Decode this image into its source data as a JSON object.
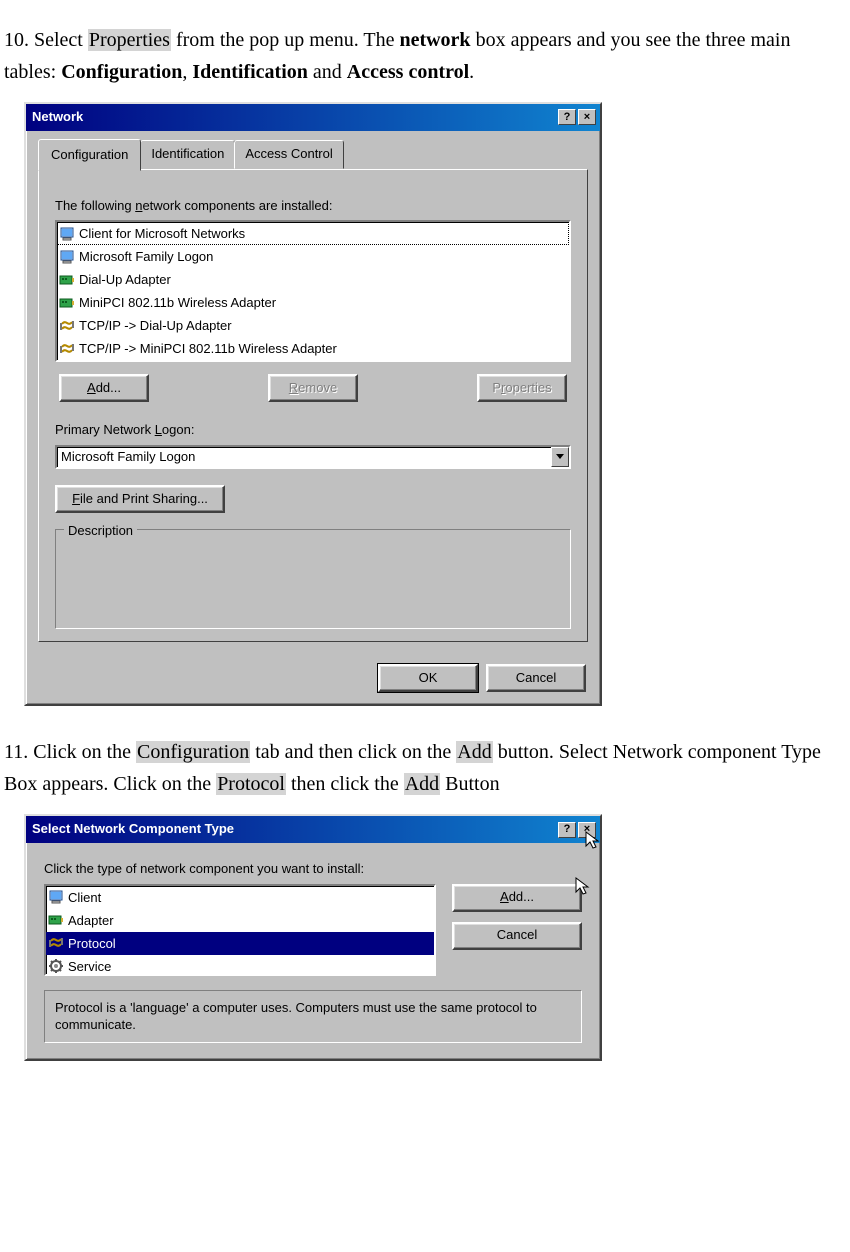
{
  "step10": {
    "prefix": "10. Select ",
    "properties": "Properties",
    "mid1": " from the pop up menu.    The ",
    "network_b": "network",
    "mid2": " box appears and you see the three main tables: ",
    "configuration_b": "Configuration",
    "comma1": ", ",
    "identification_b": "Identification",
    "and": " and ",
    "access_b": "Access control",
    "period": "."
  },
  "dlg1": {
    "title": "Network",
    "help": "?",
    "close": "×",
    "tabs": {
      "t1": "Configuration",
      "t2": "Identification",
      "t3": "Access Control"
    },
    "installed_prefix": "The following ",
    "installed_u": "n",
    "installed_suffix": "etwork components are installed:",
    "components": [
      {
        "icon": "client",
        "label": "Client for Microsoft Networks"
      },
      {
        "icon": "client",
        "label": "Microsoft Family Logon"
      },
      {
        "icon": "nic",
        "label": "Dial-Up Adapter"
      },
      {
        "icon": "nic",
        "label": "MiniPCI 802.11b Wireless Adapter"
      },
      {
        "icon": "proto",
        "label": "TCP/IP -> Dial-Up Adapter"
      },
      {
        "icon": "proto",
        "label": "TCP/IP -> MiniPCI 802.11b Wireless Adapter"
      }
    ],
    "btn_add_u": "A",
    "btn_add_rest": "dd...",
    "btn_remove_u": "R",
    "btn_remove_rest": "emove",
    "btn_props_prefix": "P",
    "btn_props_u": "r",
    "btn_props_rest": "operties",
    "primary_prefix": "Primary Network ",
    "primary_u": "L",
    "primary_suffix": "ogon:",
    "primary_value": "Microsoft Family Logon",
    "fps_u": "F",
    "fps_rest": "ile and Print Sharing...",
    "desc_legend": "Description",
    "ok": "OK",
    "cancel": "Cancel"
  },
  "step11": {
    "prefix": "11. Click on the ",
    "config_hl": "Configuration",
    "mid1": " tab and then click on the ",
    "add_hl": "Add",
    "mid2": " button. Select Network component Type Box appears.    Click on the ",
    "proto_hl": "Protocol",
    "mid3": " then click the ",
    "add2_hl": "Add",
    "suffix": " Button"
  },
  "dlg2": {
    "title": "Select Network Component Type",
    "help": "?",
    "close": "×",
    "prompt": "Click the type of network component you want to install:",
    "items": [
      {
        "icon": "client",
        "label": "Client"
      },
      {
        "icon": "nic",
        "label": "Adapter"
      },
      {
        "icon": "proto",
        "label": "Protocol"
      },
      {
        "icon": "service",
        "label": "Service"
      }
    ],
    "selected_index": 2,
    "btn_add_u": "A",
    "btn_add_rest": "dd...",
    "cancel": "Cancel",
    "desc": "Protocol is a 'language' a computer uses. Computers must use the same protocol to communicate."
  }
}
